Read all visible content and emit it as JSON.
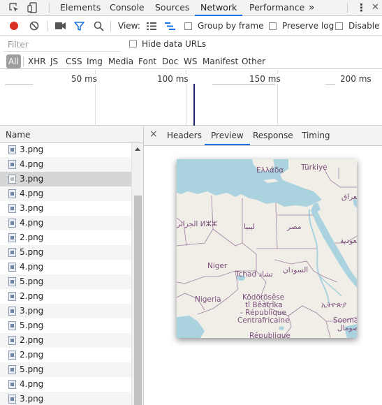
{
  "tabs": [
    "Elements",
    "Console",
    "Sources",
    "Network",
    "Performance"
  ],
  "active_tab": "Network",
  "overflow_glyph": "»",
  "more_glyph": "⋮",
  "close_glyph": "✕",
  "toolbar": {
    "view_label": "View:",
    "group_by_frame": "Group by frame",
    "preserve_log": "Preserve log",
    "disable_cache": "Disable c"
  },
  "filter": {
    "placeholder": "Filter",
    "hide_data_urls": "Hide data URLs"
  },
  "types": [
    "All",
    "XHR",
    "JS",
    "CSS",
    "Img",
    "Media",
    "Font",
    "Doc",
    "WS",
    "Manifest",
    "Other"
  ],
  "overview": {
    "labels": [
      "50 ms",
      "100 ms",
      "150 ms",
      "200 ms"
    ]
  },
  "list": {
    "header": "Name",
    "rows": [
      "3.png",
      "4.png",
      "3.png",
      "4.png",
      "3.png",
      "4.png",
      "2.png",
      "5.png",
      "4.png",
      "5.png",
      "2.png",
      "3.png",
      "5.png",
      "2.png",
      "2.png",
      "5.png",
      "4.png",
      "3.png"
    ],
    "selected_index": 2
  },
  "details": {
    "close": "×",
    "tabs": [
      "Headers",
      "Preview",
      "Response",
      "Timing"
    ],
    "active_tab": "Preview"
  },
  "map_labels": {
    "greece": "Ελλάδα",
    "turkey": "Türkiye",
    "iraq": "العراق",
    "algeria": "الجزائر ⵍⵣⵣ",
    "libya": "ليبيا",
    "egypt": "مصر",
    "saudi": "سعودية",
    "niger": "Niger",
    "chad": "Tchad تشاد",
    "sudan": "السودان",
    "nigeria": "Nigeria",
    "car_1": "Ködörösêse",
    "car_2": "tî Bêafrîka",
    "car_3": "- République",
    "car_4": "Centrafricaine",
    "ethiopia": "ኢትዮጵያ",
    "somalia_1": "Sooma",
    "somalia_2": "الصومال",
    "drc": "République"
  },
  "colors": {
    "accent": "#1a73e8",
    "record": "#d93025",
    "sea": "#aad3df",
    "land": "#f1eee8",
    "border": "#9e7fa0"
  }
}
